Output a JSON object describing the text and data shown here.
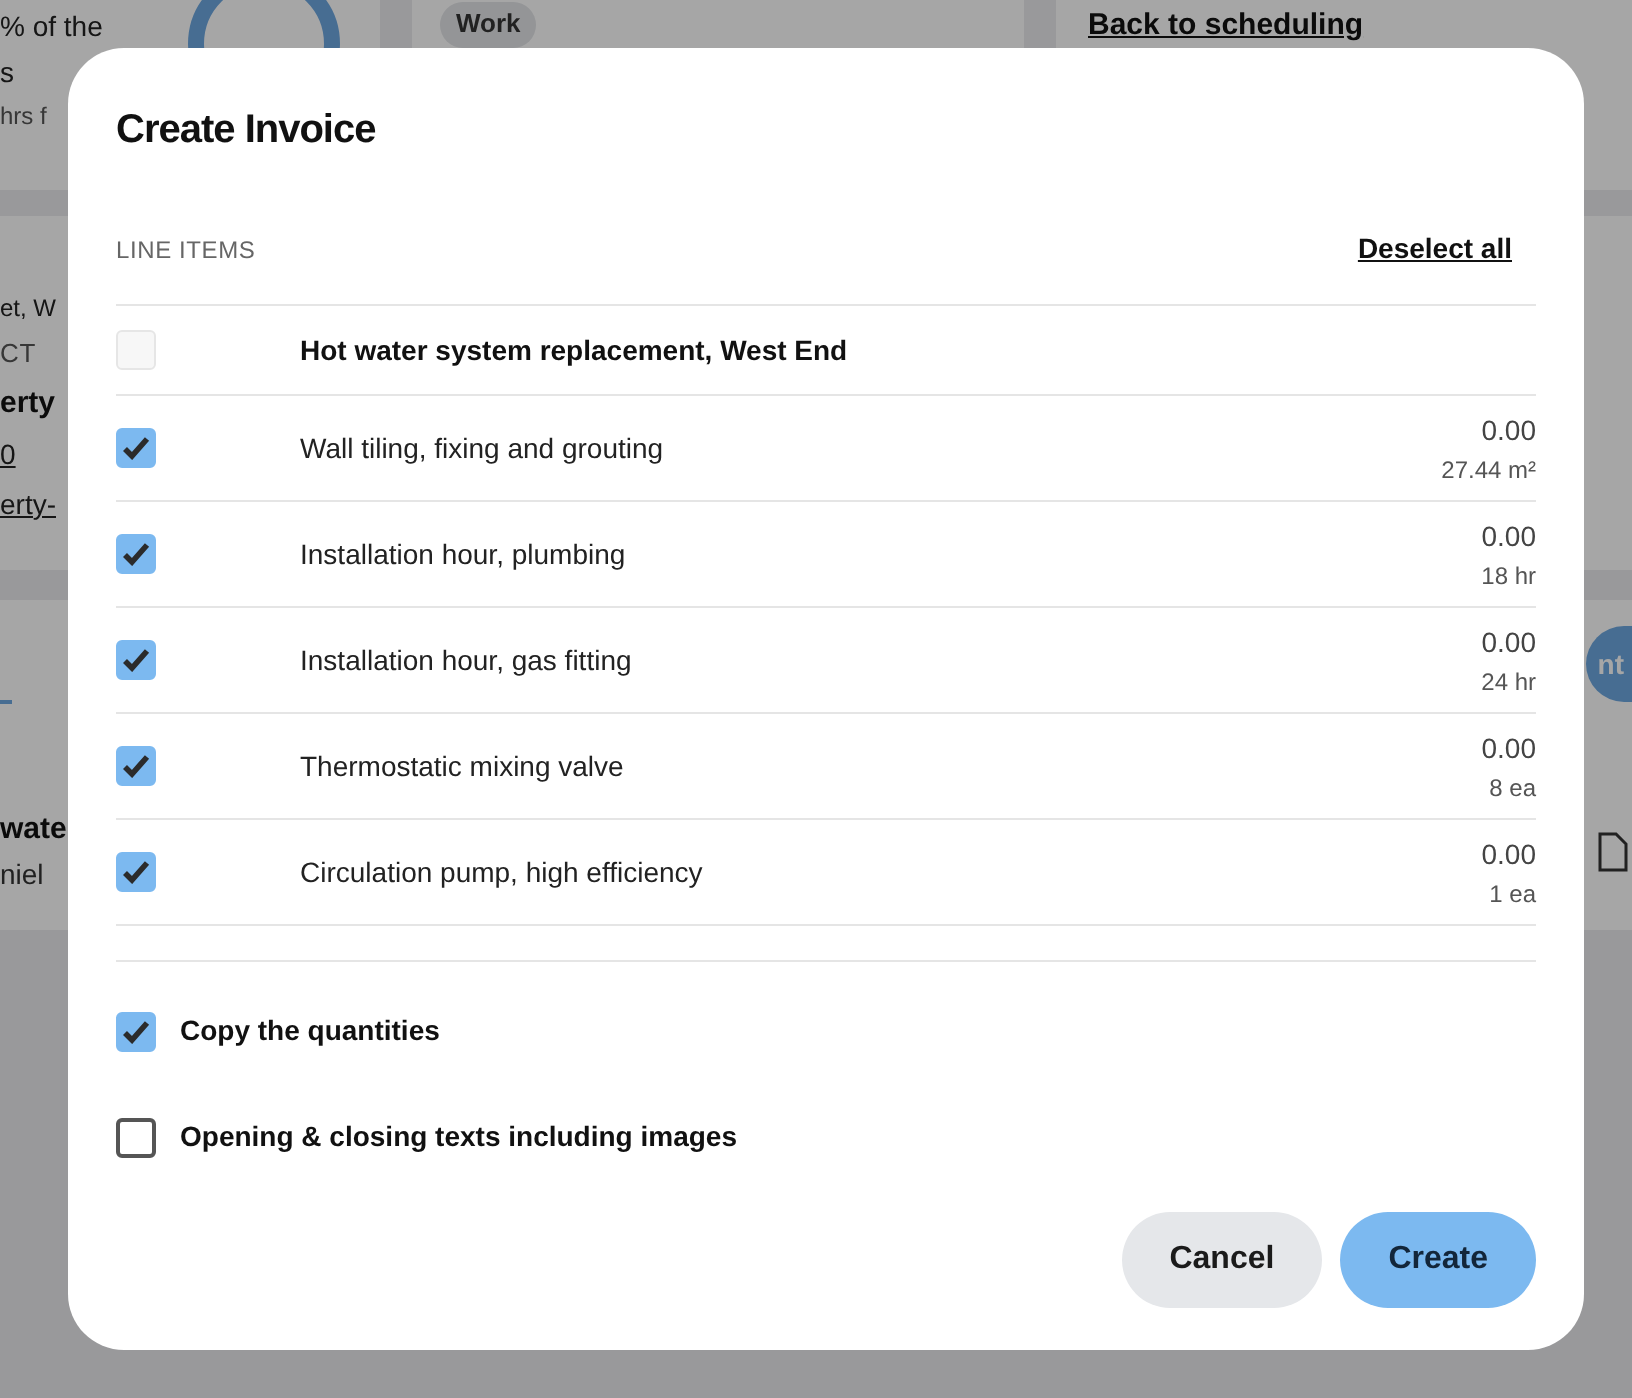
{
  "background": {
    "stat_lines": [
      "% of the",
      "s",
      "hrs f"
    ],
    "tag": "Work",
    "link": "Back to scheduling",
    "details": [
      {
        "kind": "text",
        "text": "et, W"
      },
      {
        "kind": "label",
        "text": "CT"
      },
      {
        "kind": "bold",
        "text": "erty"
      },
      {
        "kind": "link",
        "text": "0"
      },
      {
        "kind": "link",
        "text": "erty-"
      }
    ],
    "button": "nt",
    "row_title": "wate",
    "row_subtitle": "niel"
  },
  "dialog": {
    "title": "Create Invoice",
    "section_label": "LINE ITEMS",
    "deselect_all": "Deselect all",
    "line_items": [
      {
        "kind": "group",
        "label": "Hot water system replacement, West End",
        "checked": false
      },
      {
        "kind": "item",
        "label": "Wall tiling, fixing and grouting",
        "checked": true,
        "amount": "0.00",
        "quantity": "27.44 m²"
      },
      {
        "kind": "item",
        "label": "Installation hour, plumbing",
        "checked": true,
        "amount": "0.00",
        "quantity": "18 hr"
      },
      {
        "kind": "item",
        "label": "Installation hour, gas fitting",
        "checked": true,
        "amount": "0.00",
        "quantity": "24 hr"
      },
      {
        "kind": "item",
        "label": "Thermostatic mixing valve",
        "checked": true,
        "amount": "0.00",
        "quantity": "8 ea"
      },
      {
        "kind": "item",
        "label": "Circulation pump, high efficiency",
        "checked": true,
        "amount": "0.00",
        "quantity": "1 ea"
      }
    ],
    "options": [
      {
        "label": "Copy the quantities",
        "checked": true
      },
      {
        "label": "Opening & closing texts including images",
        "checked": false
      }
    ],
    "buttons": [
      {
        "kind": "secondary",
        "label": "Cancel"
      },
      {
        "kind": "primary",
        "label": "Create"
      }
    ]
  }
}
